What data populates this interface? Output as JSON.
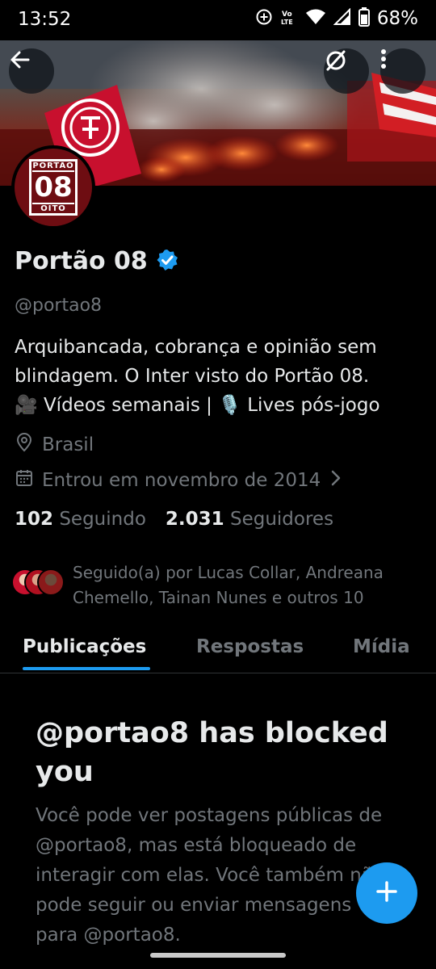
{
  "status_bar": {
    "time": "13:52",
    "battery_pct": "68%",
    "icons": [
      "data-saver-icon",
      "volte-icon",
      "wifi-icon",
      "signal-icon",
      "battery-icon"
    ]
  },
  "header": {
    "back_icon": "arrow-left-icon",
    "grok_icon": "slash-circle-icon",
    "more_icon": "more-vertical-icon"
  },
  "avatar": {
    "top_text": "PORTÃO",
    "number": "08",
    "bottom_text": "OITO"
  },
  "profile": {
    "name": "Portão 08",
    "verified_icon": "verified-badge-icon",
    "handle": "@portao8",
    "bio_line1": "Arquibancada, cobrança e opinião sem",
    "bio_line2": "blindagem. O Inter visto do Portão 08.",
    "bio_line3_video_emoji": "🎥",
    "bio_line3_a": " Vídeos semanais | ",
    "bio_line3_mic_emoji": "🎙️",
    "bio_line3_b": " Lives pós-jogo",
    "location": "Brasil",
    "joined": "Entrou em novembro de 2014",
    "following_count": "102",
    "following_label": "Seguindo",
    "followers_count": "2.031",
    "followers_label": "Seguidores",
    "followed_by": "Seguido(a) por Lucas Collar, Andreana Chemello, Tainan Nunes e outros 10"
  },
  "tabs": [
    {
      "label": "Publicações",
      "active": true
    },
    {
      "label": "Respostas",
      "active": false
    },
    {
      "label": "Mídia",
      "active": false
    }
  ],
  "blocked": {
    "title": "@portao8 has blocked you",
    "text": "Você pode ver postagens públicas de @portao8, mas está bloqueado de interagir com elas. Você também não pode seguir ou enviar mensagens para @portao8."
  },
  "fab": {
    "icon": "plus-icon"
  },
  "colors": {
    "accent": "#1d9bf0",
    "background": "#000000",
    "secondary_text": "#71767b",
    "primary_text": "#e7e9ea",
    "club_red": "#c8102e"
  }
}
